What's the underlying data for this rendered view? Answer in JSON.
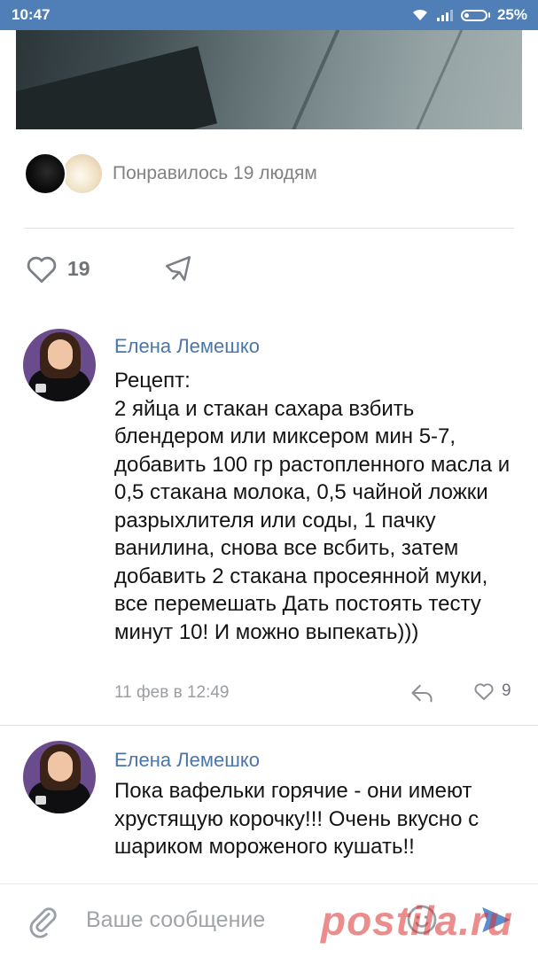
{
  "status_bar": {
    "time": "10:47",
    "battery": "25%"
  },
  "post": {
    "likes_summary": "Понравилось 19 людям",
    "like_count": "19"
  },
  "comments": [
    {
      "author": "Елена Лемешко",
      "text": "Рецепт:\n2 яйца и стакан сахара взбить блендером или миксером мин 5-7, добавить 100 гр растопленного масла и 0,5 стакана молока, 0,5 чайной ложки разрыхлителя или соды, 1 пачку ванилина, снова все всбить, затем добавить 2 стакана просеянной муки, все перемешать Дать постоять тесту  минут 10! И можно выпекать)))",
      "date": "11 фев в 12:49",
      "likes": "9"
    },
    {
      "author": "Елена Лемешко",
      "text": "Пока вафельки горячие - они имеют хрустящую корочку!!! Очень вкусно с шариком мороженого кушать!!"
    }
  ],
  "composer": {
    "placeholder": "Ваше сообщение"
  },
  "watermark": "postila.ru",
  "colors": {
    "status_bar": "#4f7fb6",
    "author_name": "#4a76a8",
    "meta_text": "#9a9ea3",
    "send_icon": "#5b8fd0"
  },
  "icons": [
    "wifi-icon",
    "signal-icon",
    "battery-icon",
    "heart-icon",
    "share-icon",
    "reply-icon",
    "paperclip-icon",
    "emoji-icon",
    "send-icon"
  ]
}
